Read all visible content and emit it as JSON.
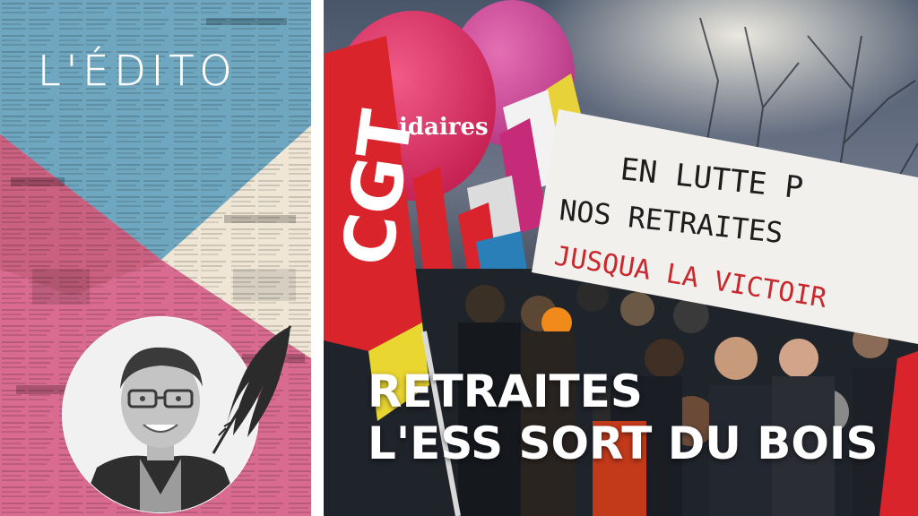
{
  "edito_label": "L'ÉDITO",
  "headline": {
    "line1": "RETRAITES",
    "line2": "L'ESS SORT DU BOIS"
  },
  "banner": {
    "line1": "EN LUTTE P",
    "line2": "NOS RETRAITES",
    "line3": "JUSQUA LA VICTOIR"
  },
  "balloon_text": "Solidaires",
  "flag_text": "CGT",
  "colors": {
    "panel_blue": "#6fa7c0",
    "panel_pink": "#d96b90",
    "panel_cream": "#efe6d6",
    "flag_red": "#d8242a",
    "balloon_pink": "#e0346a",
    "banner_ink": "#1d1d1d",
    "banner_red": "#c8282e"
  },
  "icons": {
    "feather": "feather-quill-icon",
    "portrait": "author-avatar"
  }
}
